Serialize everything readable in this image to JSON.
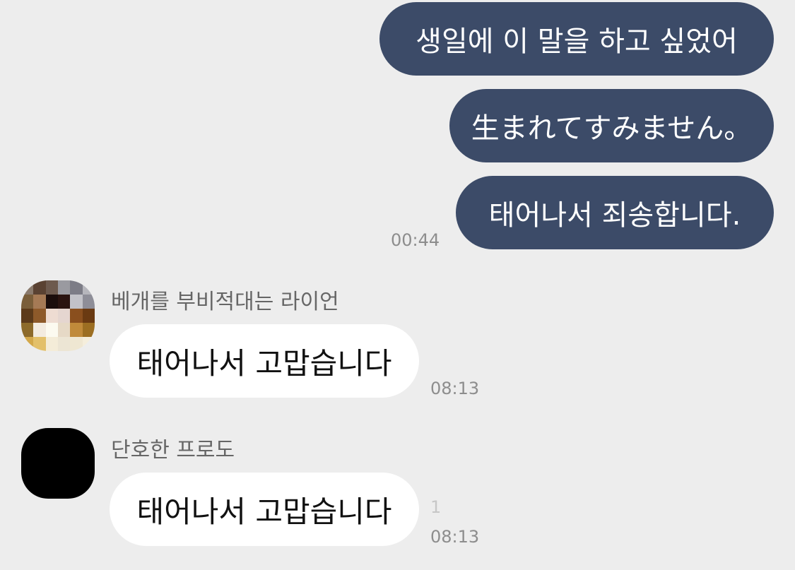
{
  "messages": {
    "outgoing": [
      {
        "text": "생일에 이 말을 하고 싶었어"
      },
      {
        "text": "生まれてすみません。"
      },
      {
        "text": "태어나서 죄송합니다."
      }
    ],
    "outgoing_time": "00:44",
    "incoming": [
      {
        "sender": "베개를 부비적대는 라이언",
        "text": "태어나서 고맙습니다",
        "time": "08:13",
        "avatar": "pixelated-profile-icon"
      },
      {
        "sender": "단호한 프로도",
        "text": "태어나서 고맙습니다",
        "time": "08:13",
        "unread": "1",
        "avatar": "black-profile-icon"
      }
    ]
  },
  "colors": {
    "background": "#ededed",
    "outgoing_bubble": "#3c4b68",
    "incoming_bubble": "#ffffff"
  }
}
